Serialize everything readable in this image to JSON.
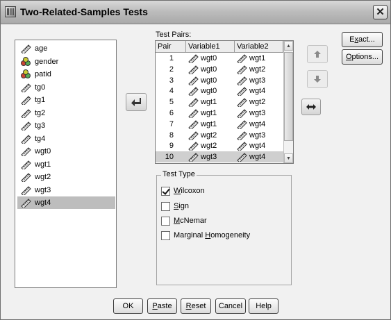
{
  "window": {
    "title": "Two-Related-Samples Tests",
    "close_glyph": "✕"
  },
  "variables": [
    {
      "label": "age",
      "icon": "scale-ruler-icon"
    },
    {
      "label": "gender",
      "icon": "nominal-icon"
    },
    {
      "label": "patid",
      "icon": "nominal-icon"
    },
    {
      "label": "tg0",
      "icon": "scale-ruler-icon"
    },
    {
      "label": "tg1",
      "icon": "scale-ruler-icon"
    },
    {
      "label": "tg2",
      "icon": "scale-ruler-icon"
    },
    {
      "label": "tg3",
      "icon": "scale-ruler-icon"
    },
    {
      "label": "tg4",
      "icon": "scale-ruler-icon"
    },
    {
      "label": "wgt0",
      "icon": "scale-ruler-icon"
    },
    {
      "label": "wgt1",
      "icon": "scale-ruler-icon"
    },
    {
      "label": "wgt2",
      "icon": "scale-ruler-icon"
    },
    {
      "label": "wgt3",
      "icon": "scale-ruler-icon"
    },
    {
      "label": "wgt4",
      "icon": "scale-ruler-icon",
      "selected": true
    }
  ],
  "test_pairs": {
    "label": "Test Pairs:",
    "columns": [
      "Pair",
      "Variable1",
      "Variable2"
    ],
    "rows": [
      {
        "pair": "1",
        "v1": "wgt0",
        "v2": "wgt1"
      },
      {
        "pair": "2",
        "v1": "wgt0",
        "v2": "wgt2"
      },
      {
        "pair": "3",
        "v1": "wgt0",
        "v2": "wgt3"
      },
      {
        "pair": "4",
        "v1": "wgt0",
        "v2": "wgt4"
      },
      {
        "pair": "5",
        "v1": "wgt1",
        "v2": "wgt2"
      },
      {
        "pair": "6",
        "v1": "wgt1",
        "v2": "wgt3"
      },
      {
        "pair": "7",
        "v1": "wgt1",
        "v2": "wgt4"
      },
      {
        "pair": "8",
        "v1": "wgt2",
        "v2": "wgt3"
      },
      {
        "pair": "9",
        "v1": "wgt2",
        "v2": "wgt4"
      },
      {
        "pair": "10",
        "v1": "wgt3",
        "v2": "wgt4",
        "selected": true
      }
    ]
  },
  "test_type": {
    "legend": "Test Type",
    "options": [
      {
        "pre": "",
        "key": "W",
        "post": "ilcoxon",
        "checked": true
      },
      {
        "pre": "",
        "key": "S",
        "post": "ign",
        "checked": false
      },
      {
        "pre": "",
        "key": "M",
        "post": "cNemar",
        "checked": false
      },
      {
        "pre": "Marginal ",
        "key": "H",
        "post": "omogeneity",
        "checked": false
      }
    ]
  },
  "side_buttons": {
    "exact": {
      "pre": "E",
      "key": "x",
      "post": "act..."
    },
    "options": {
      "pre": "",
      "key": "O",
      "post": "ptions..."
    }
  },
  "bottom_buttons": {
    "ok": {
      "pre": "OK",
      "key": "",
      "post": ""
    },
    "paste": {
      "pre": "",
      "key": "P",
      "post": "aste"
    },
    "reset": {
      "pre": "",
      "key": "R",
      "post": "eset"
    },
    "cancel": {
      "pre": "Cancel",
      "key": "",
      "post": ""
    },
    "help": {
      "pre": "Help",
      "key": "",
      "post": ""
    }
  },
  "colors": {
    "selection": "#bdbdbd",
    "face": "#f1f1f1"
  }
}
